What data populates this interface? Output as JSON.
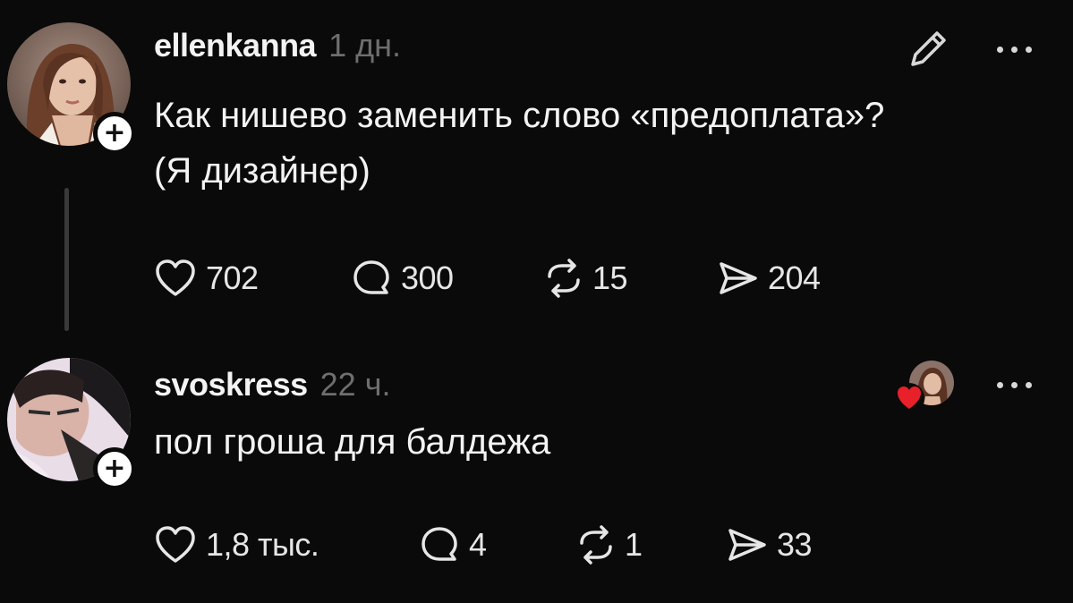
{
  "posts": [
    {
      "username": "ellenkanna",
      "time": "1 дн.",
      "text_lines": [
        "Как нишево заменить слово «предоплата»?",
        "(Я дизайнер)"
      ],
      "likes": "702",
      "replies": "300",
      "reposts": "15",
      "shares": "204"
    },
    {
      "username": "svoskress",
      "time": "22 ч.",
      "text_lines": [
        "пол гроша для балдежа"
      ],
      "likes": "1,8 тыс.",
      "replies": "4",
      "reposts": "1",
      "shares": "33"
    }
  ],
  "icons": {
    "like": "heart-icon",
    "reply": "comment-icon",
    "repost": "repost-icon",
    "share": "send-icon",
    "edit": "pencil-icon",
    "more": "more-icon",
    "follow": "plus-icon",
    "liked_by": "red-heart-icon"
  },
  "colors": {
    "background": "#0a0a0a",
    "text": "#f3f3f3",
    "muted": "#6e6e6e",
    "thread_line": "#3a3a3a",
    "heart_red": "#e8202a"
  }
}
